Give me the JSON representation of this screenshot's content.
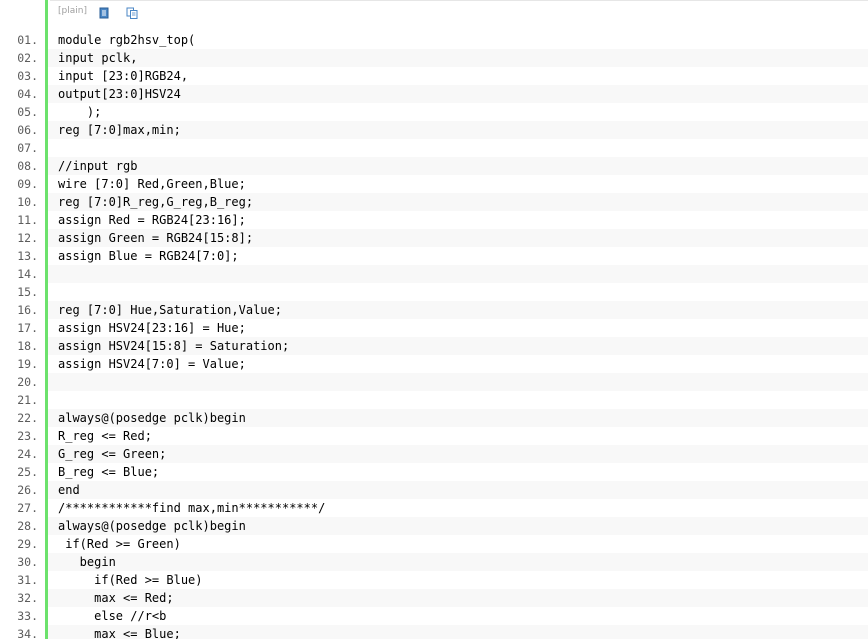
{
  "toolbar": {
    "plain_label": "[plain]",
    "view_icon": "document-icon",
    "copy_icon": "copy-icon"
  },
  "colors": {
    "gutter_bar": "#6ce26c",
    "line_number": "#5c5c5c",
    "alt_row": "#f8f8f8",
    "toolbar_text": "#a0a0a0"
  },
  "code": {
    "lines": [
      {
        "num": "01.",
        "text": "module rgb2hsv_top("
      },
      {
        "num": "02.",
        "text": "input pclk,"
      },
      {
        "num": "03.",
        "text": "input [23:0]RGB24,"
      },
      {
        "num": "04.",
        "text": "output[23:0]HSV24"
      },
      {
        "num": "05.",
        "text": "    );"
      },
      {
        "num": "06.",
        "text": "reg [7:0]max,min;"
      },
      {
        "num": "07.",
        "text": ""
      },
      {
        "num": "08.",
        "text": "//input rgb"
      },
      {
        "num": "09.",
        "text": "wire [7:0] Red,Green,Blue;"
      },
      {
        "num": "10.",
        "text": "reg [7:0]R_reg,G_reg,B_reg;"
      },
      {
        "num": "11.",
        "text": "assign Red = RGB24[23:16];"
      },
      {
        "num": "12.",
        "text": "assign Green = RGB24[15:8];"
      },
      {
        "num": "13.",
        "text": "assign Blue = RGB24[7:0];"
      },
      {
        "num": "14.",
        "text": ""
      },
      {
        "num": "15.",
        "text": ""
      },
      {
        "num": "16.",
        "text": "reg [7:0] Hue,Saturation,Value;"
      },
      {
        "num": "17.",
        "text": "assign HSV24[23:16] = Hue;"
      },
      {
        "num": "18.",
        "text": "assign HSV24[15:8] = Saturation;"
      },
      {
        "num": "19.",
        "text": "assign HSV24[7:0] = Value;"
      },
      {
        "num": "20.",
        "text": ""
      },
      {
        "num": "21.",
        "text": ""
      },
      {
        "num": "22.",
        "text": "always@(posedge pclk)begin"
      },
      {
        "num": "23.",
        "text": "R_reg <= Red;"
      },
      {
        "num": "24.",
        "text": "G_reg <= Green;"
      },
      {
        "num": "25.",
        "text": "B_reg <= Blue;"
      },
      {
        "num": "26.",
        "text": "end"
      },
      {
        "num": "27.",
        "text": "/************find max,min***********/"
      },
      {
        "num": "28.",
        "text": "always@(posedge pclk)begin"
      },
      {
        "num": "29.",
        "text": " if(Red >= Green)"
      },
      {
        "num": "30.",
        "text": "   begin"
      },
      {
        "num": "31.",
        "text": "     if(Red >= Blue)"
      },
      {
        "num": "32.",
        "text": "     max <= Red;"
      },
      {
        "num": "33.",
        "text": "     else //r<b"
      },
      {
        "num": "34.",
        "text": "     max <= Blue;"
      }
    ]
  }
}
